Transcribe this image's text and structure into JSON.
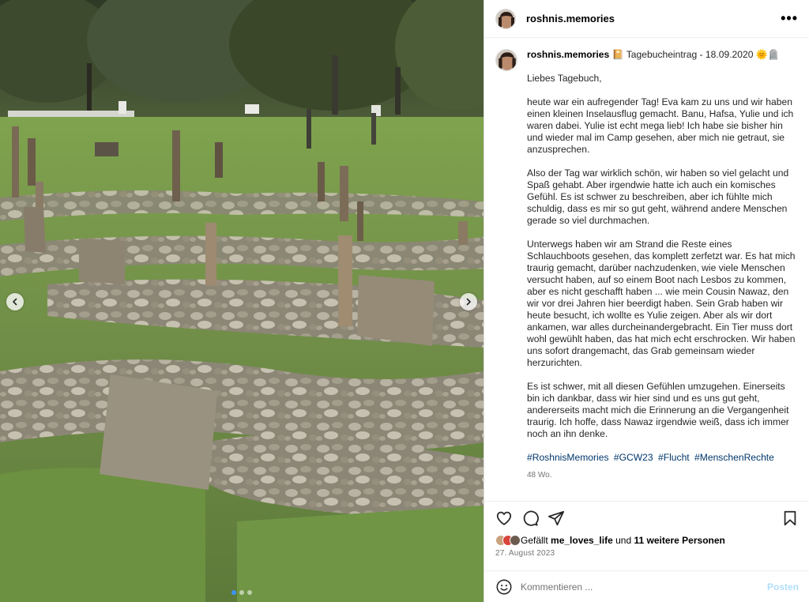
{
  "post": {
    "username": "roshnis.memories",
    "more_label": "•••",
    "image_alt": "Friedhof mit Grabsteinen auf Lesbos"
  },
  "caption": {
    "username": "roshnis.memories",
    "title": "📔 Tagebucheintrag - 18.09.2020 🌞🪦",
    "greeting": "Liebes Tagebuch,",
    "paragraphs": [
      "heute war ein aufregender Tag! Eva kam zu uns und wir haben einen kleinen Inselausflug gemacht. Banu, Hafsa, Yulie und ich waren dabei. Yulie ist echt mega lieb! Ich habe sie bisher hin und wieder mal im Camp gesehen, aber mich nie getraut, sie anzusprechen.",
      "Also der Tag war wirklich schön, wir haben so viel gelacht und Spaß gehabt. Aber irgendwie hatte ich auch ein komisches Gefühl. Es ist schwer zu beschreiben, aber ich fühlte mich schuldig, dass es mir so gut geht, während andere Menschen gerade so viel durchmachen.",
      "Unterwegs haben wir am Strand die Reste eines Schlauchboots gesehen, das komplett zerfetzt war. Es hat mich traurig gemacht, darüber nachzudenken, wie viele Menschen versucht haben, auf so einem Boot nach Lesbos zu kommen, aber es nicht geschafft haben ... wie mein Cousin Nawaz, den wir vor drei Jahren hier beerdigt haben. Sein Grab haben wir heute besucht, ich wollte es Yulie zeigen. Aber als wir dort ankamen, war alles durcheinandergebracht. Ein Tier muss dort wohl gewühlt haben, das hat mich echt erschrocken. Wir haben uns sofort drangemacht, das Grab gemeinsam wieder herzurichten.",
      "Es ist schwer, mit all diesen Gefühlen umzugehen. Einerseits bin ich dankbar, dass wir hier sind und es uns gut geht, andererseits macht mich die Erinnerung an die Vergangenheit traurig. Ich hoffe, dass Nawaz irgendwie weiß, dass ich immer noch an ihn denke."
    ],
    "hashtags": [
      "#RoshnisMemories",
      "#GCW23",
      "#Flucht",
      "#MenschenRechte"
    ],
    "age": "48 Wo."
  },
  "actions": {
    "like_icon": "heart-icon",
    "comment_icon": "comment-icon",
    "share_icon": "paper-plane-icon",
    "save_icon": "bookmark-icon"
  },
  "likes": {
    "prefix": "Gefällt",
    "user": "me_loves_life",
    "connector": "und",
    "others": "11 weitere Personen",
    "avatar_colors": [
      "#c9a27e",
      "#d8433a",
      "#6b5b4e"
    ]
  },
  "date": "27. August 2023",
  "comment": {
    "placeholder": "Kommentieren ...",
    "post_label": "Posten",
    "emoji_icon": "emoji-icon"
  },
  "carousel": {
    "prev_icon": "chevron-left-icon",
    "next_icon": "chevron-right-icon",
    "slide_count": 3,
    "active_index": 0
  },
  "colors": {
    "link": "#00376b",
    "muted": "#737373",
    "post_button_disabled": "#b2dffc",
    "carousel_active_dot": "#3b95f5"
  }
}
